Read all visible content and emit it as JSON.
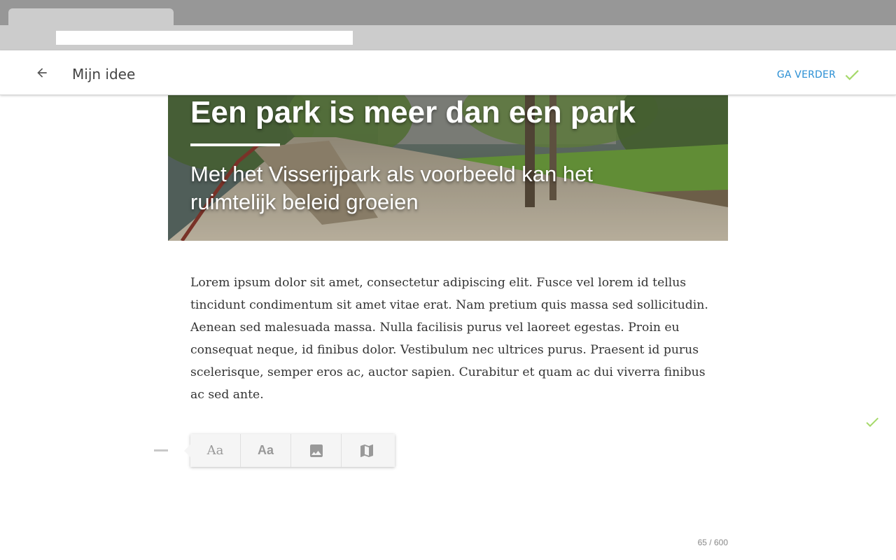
{
  "header": {
    "title": "Mijn idee",
    "continue_label": "GA VERDER"
  },
  "hero": {
    "title": "Een park is meer dan een park",
    "subtitle": "Met het Visserijpark als voorbeeld kan het ruimtelijk beleid groeien"
  },
  "article": {
    "body": "Lorem ipsum dolor sit amet, consectetur adipiscing elit. Fusce vel lorem id tellus tincidunt condimentum sit amet vitae erat. Nam pretium quis massa sed sollicitudin. Aenean sed malesuada massa. Nulla facilisis purus vel laoreet egestas. Proin eu consequat neque, id finibus dolor. Vestibulum nec ultrices purus. Praesent id purus scelerisque, semper eros ac, auctor sapien. Curabitur et quam ac dui viverra finibus ac sed ante."
  },
  "toolbar": {
    "serif_text_label": "Aa",
    "sans_text_label": "Aa"
  },
  "counter": "65 / 600",
  "colors": {
    "accent_blue": "#2a8fd4",
    "check_green": "#a6d96a",
    "chrome_dark": "#979797",
    "chrome_light": "#cccccc"
  },
  "icons": [
    "arrow-back-icon",
    "check-icon",
    "image-icon",
    "map-icon"
  ]
}
